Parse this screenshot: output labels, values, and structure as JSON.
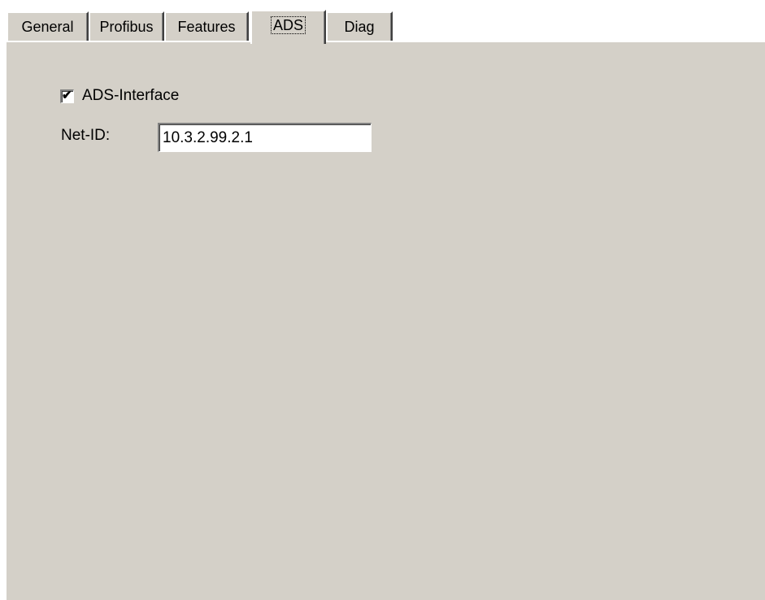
{
  "tabs": [
    {
      "label": "General",
      "active": false
    },
    {
      "label": "Profibus",
      "active": false
    },
    {
      "label": "Features",
      "active": false
    },
    {
      "label": "ADS",
      "active": true
    },
    {
      "label": "Diag",
      "active": false
    }
  ],
  "ads_panel": {
    "ads_interface_label": "ADS-Interface",
    "ads_interface_checked": true,
    "net_id_label": "Net-ID:",
    "net_id_value": "10.3.2.99.2.1"
  },
  "colors": {
    "face": "#d4d0c8",
    "highlight": "#ffffff",
    "shadow": "#808080",
    "dark_shadow": "#404040"
  }
}
